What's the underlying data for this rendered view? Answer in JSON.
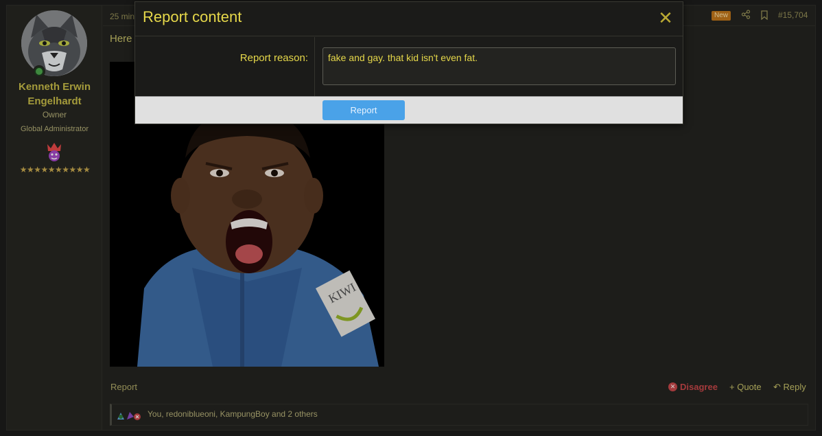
{
  "post": {
    "author": {
      "name": "Kenneth Erwin Engelhardt",
      "title": "Owner",
      "role": "Global Administrator",
      "stars": "★★★★★★★★★★",
      "avatar_icon": "cat-avatar-icon",
      "online_icon": "online-status-icon",
      "rank_icon": "crown-icon"
    },
    "time": "25 min",
    "badge_new": "New",
    "number": "#15,704",
    "text": "Here",
    "image_icon": "screaming-child-image",
    "actions": {
      "report": "Report",
      "disagree": "Disagree",
      "quote": "+ Quote",
      "reply": "Reply"
    },
    "reactions": {
      "text": "You, redoniblueoni, KampungBoy and 2 others",
      "icons": [
        "reaction-icon",
        "reaction-icon",
        "disagree-icon"
      ]
    }
  },
  "dialog": {
    "title": "Report content",
    "close_symbol": "✕",
    "reason_label": "Report reason:",
    "reason_value": "fake and gay. that kid isn't even fat.",
    "submit_label": "Report"
  },
  "colors": {
    "accent": "#e6d84a",
    "button": "#4aa2e8",
    "disagree": "#c9474a",
    "new_badge": "#c3771a"
  }
}
